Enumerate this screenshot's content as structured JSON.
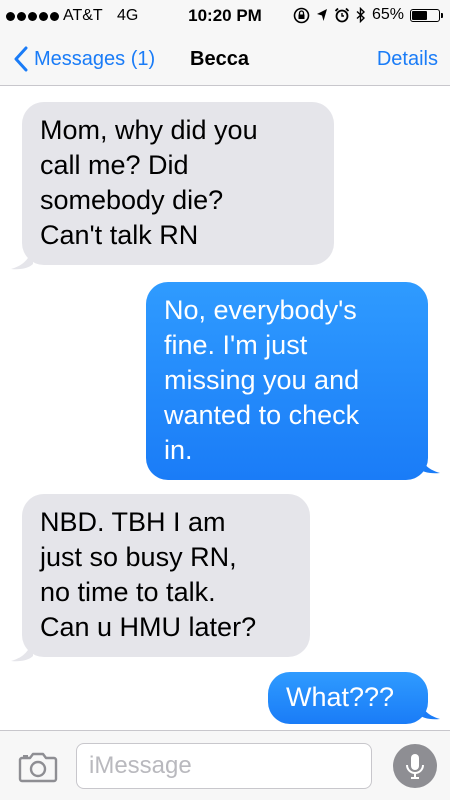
{
  "status_bar": {
    "carrier": "AT&T",
    "network": "4G",
    "time": "10:20 PM",
    "battery_percent": "65%",
    "battery_level": 0.65,
    "icons": [
      "lock-rotation-icon",
      "location-icon",
      "alarm-icon",
      "bluetooth-icon",
      "battery-icon"
    ]
  },
  "nav": {
    "back_label": "Messages (1)",
    "title": "Becca",
    "details_label": "Details"
  },
  "messages": [
    {
      "direction": "incoming",
      "lines": [
        "Mom, why did you",
        "call me?  Did",
        "somebody die?",
        "Can't talk RN"
      ]
    },
    {
      "direction": "outgoing",
      "lines": [
        "No, everybody's",
        "fine.  I'm just",
        "missing you and",
        "wanted to check",
        "in."
      ]
    },
    {
      "direction": "incoming",
      "lines": [
        "NBD.  TBH I am",
        "just so busy RN,",
        "no time to talk.",
        "Can u HMU later?"
      ]
    },
    {
      "direction": "outgoing",
      "lines": [
        "What???"
      ]
    }
  ],
  "input": {
    "placeholder": "iMessage",
    "value": ""
  },
  "colors": {
    "accent": "#1a7cf7",
    "incoming_bubble": "#e5e5ea",
    "outgoing_bubble": "#1a8cff",
    "bar_background": "#f7f7f7"
  }
}
